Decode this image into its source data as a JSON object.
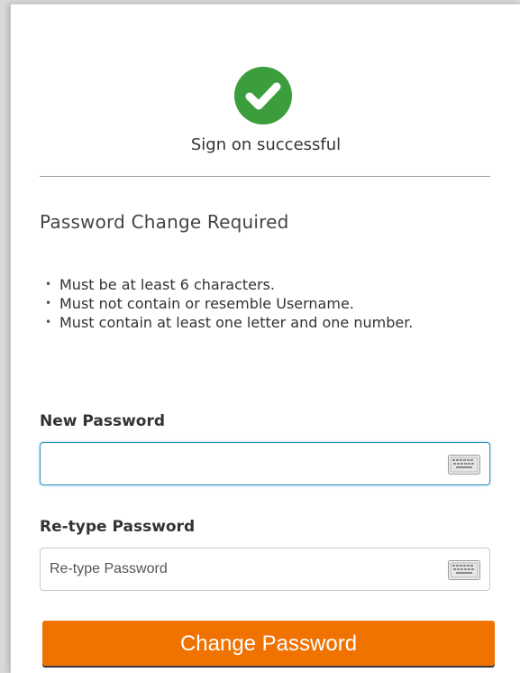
{
  "status": {
    "message": "Sign on successful",
    "icon": "check-circle-icon",
    "color": "#3c9d3c"
  },
  "form": {
    "heading": "Password Change Required",
    "rules": [
      "Must be at least 6 characters.",
      "Must not contain or resemble Username.",
      "Must contain at least one letter and one number."
    ],
    "new_password": {
      "label": "New Password",
      "value": "",
      "placeholder": ""
    },
    "retype_password": {
      "label": "Re-type Password",
      "value": "",
      "placeholder": "Re-type Password"
    },
    "keyboard_icon": "virtual-keyboard-icon",
    "submit_label": "Change Password",
    "accent_color": "#f07200",
    "focus_color": "#2a8fbd"
  }
}
